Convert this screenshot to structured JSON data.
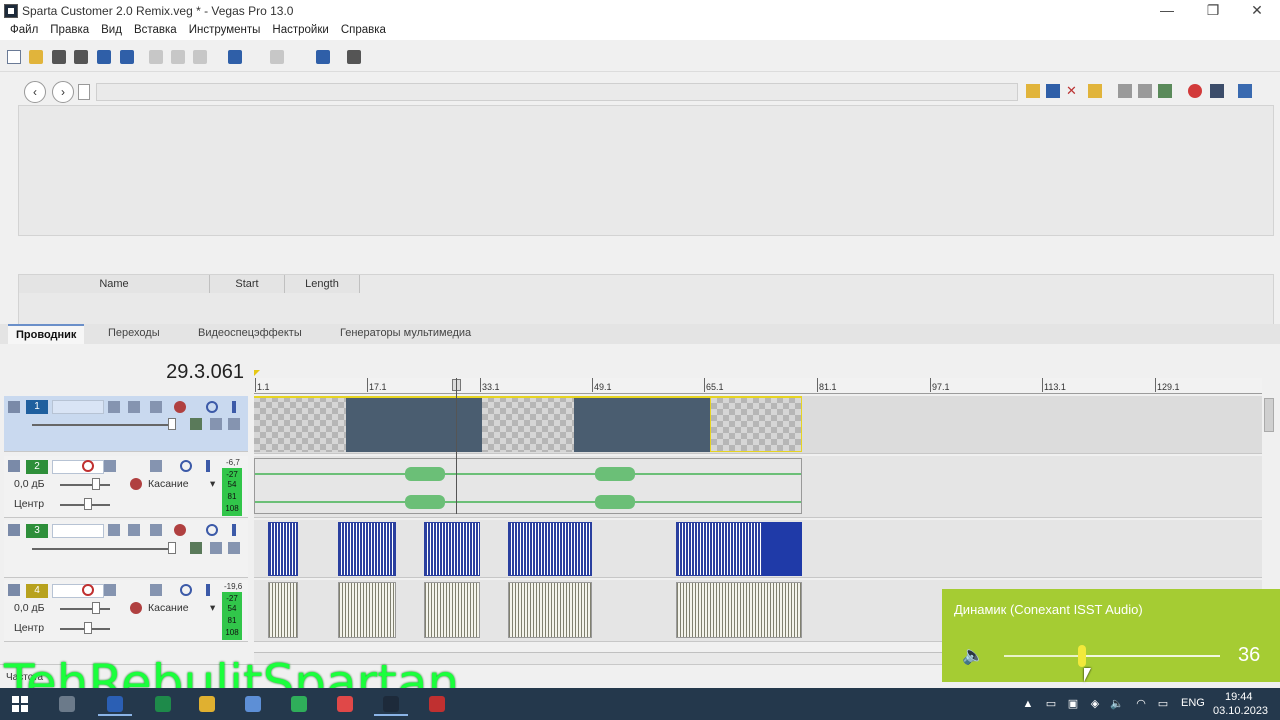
{
  "window": {
    "title": "Sparta Customer 2.0 Remix.veg * - Vegas Pro 13.0",
    "minimize": "—",
    "restore": "❐",
    "close": "✕"
  },
  "menu": [
    "Файл",
    "Правка",
    "Вид",
    "Вставка",
    "Инструменты",
    "Настройки",
    "Справка"
  ],
  "explorer": {
    "back": "‹",
    "forward": "›",
    "columns": [
      "Name",
      "Start",
      "Length"
    ],
    "tabs": [
      "Проводник",
      "Переходы",
      "Видеоспецэффекты",
      "Генераторы мультимедиа"
    ]
  },
  "timeline": {
    "time": "29.3.061",
    "ruler": [
      "1.1",
      "17.1",
      "33.1",
      "49.1",
      "65.1",
      "81.1",
      "97.1",
      "113.1",
      "129.1"
    ],
    "tracks": [
      {
        "num": "1",
        "type": "video",
        "color": "#1f5f9e"
      },
      {
        "num": "2",
        "type": "audio",
        "color": "#2e8f3a",
        "volume": "0,0 дБ",
        "pan": "Центр",
        "mode": "Касание",
        "level": "-6,7",
        "meter": [
          "-27",
          "54",
          "81",
          "108"
        ]
      },
      {
        "num": "3",
        "type": "video",
        "color": "#2e8f3a"
      },
      {
        "num": "4",
        "type": "audio",
        "color": "#b8a21e",
        "volume": "0,0 дБ",
        "pan": "Центр",
        "mode": "Касание",
        "level": "-19,6",
        "meter": [
          "-27",
          "54",
          "81",
          "108"
        ]
      }
    ],
    "rate_label": "Частота"
  },
  "volume_flyout": {
    "device": "Динамик (Conexant ISST Audio)",
    "value": "36",
    "level": 0.36
  },
  "taskbar": {
    "lang": "ENG",
    "time": "19:44",
    "date": "03.10.2023"
  },
  "watermark": "TehRebulitSpartan",
  "colors": {
    "accent": "#a5cc33",
    "taskbar": "#24384c",
    "watermark": "#1aff3c"
  }
}
